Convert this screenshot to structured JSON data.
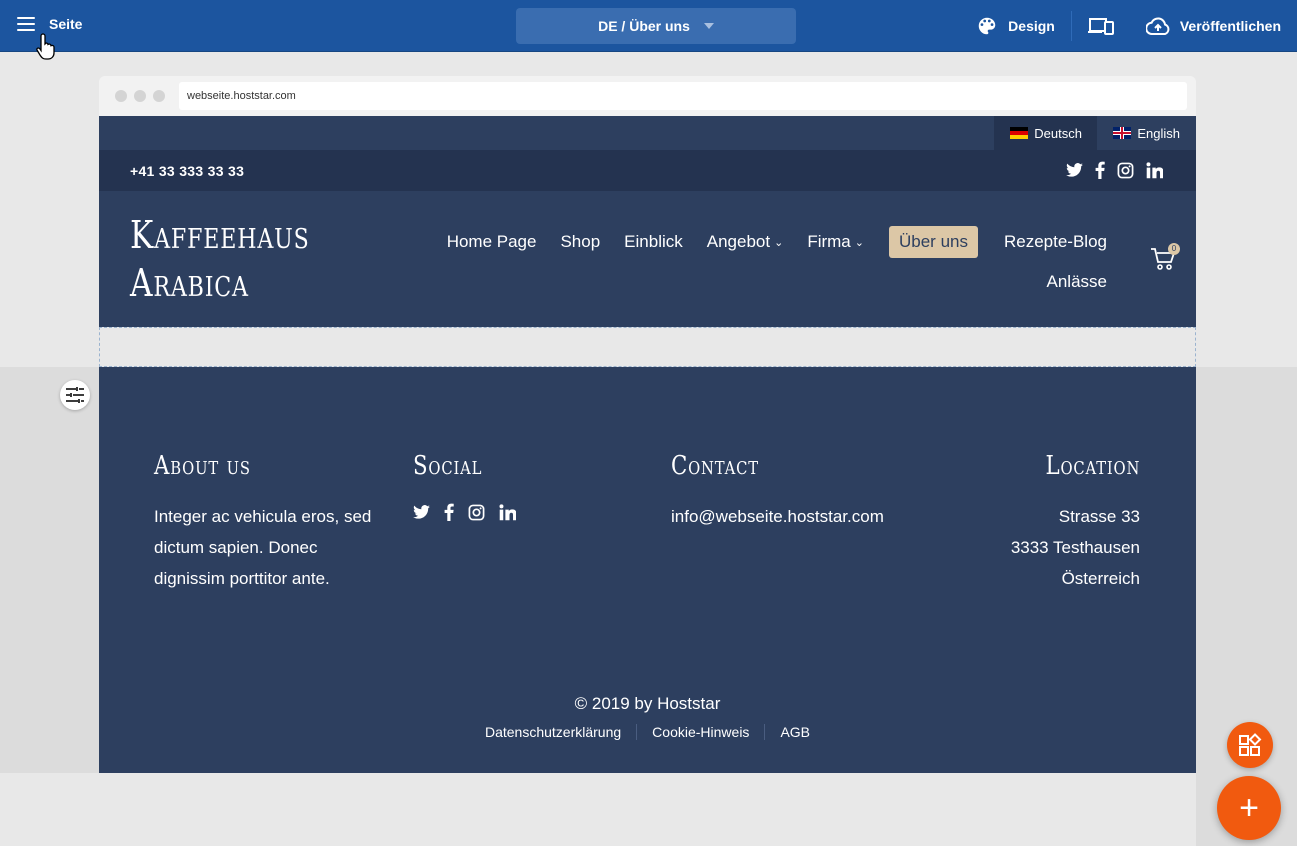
{
  "appbar": {
    "menu_label": "Seite",
    "page_selector": "DE / Über uns",
    "design_label": "Design",
    "publish_label": "Veröffentlichen"
  },
  "browser": {
    "url": "webseite.hoststar.com"
  },
  "site": {
    "languages": [
      {
        "label": "Deutsch",
        "flag": "de-flag-icon"
      },
      {
        "label": "English",
        "flag": "uk-flag-icon"
      }
    ],
    "phone": "+41 33 333 33 33",
    "logo_line1": "Kaffeehaus",
    "logo_line2": "Arabica",
    "nav": {
      "home": "Home Page",
      "shop": "Shop",
      "einblick": "Einblick",
      "angebot": "Angebot",
      "firma": "Firma",
      "ueber": "Über uns",
      "blog": "Rezepte-Blog",
      "anlaesse": "Anlässe"
    },
    "cart_count": "0",
    "accent_color": "#dcc7a6",
    "primary_color": "#2d3f5f"
  },
  "footer": {
    "about": {
      "title": "About us",
      "text": "Integer ac vehicula eros, sed dictum sapien. Donec dignissim porttitor ante."
    },
    "social": {
      "title": "Social"
    },
    "contact": {
      "title": "Contact",
      "email": "info@webseite.hoststar.com"
    },
    "location": {
      "title": "Location",
      "street": "Strasse 33",
      "city": "3333 Testhausen",
      "country": "Österreich"
    },
    "copyright": "© 2019 by Hoststar",
    "legal": {
      "privacy": "Datenschutzerklärung",
      "cookie": "Cookie-Hinweis",
      "agb": "AGB"
    }
  },
  "fab": {
    "add_symbol": "+"
  }
}
